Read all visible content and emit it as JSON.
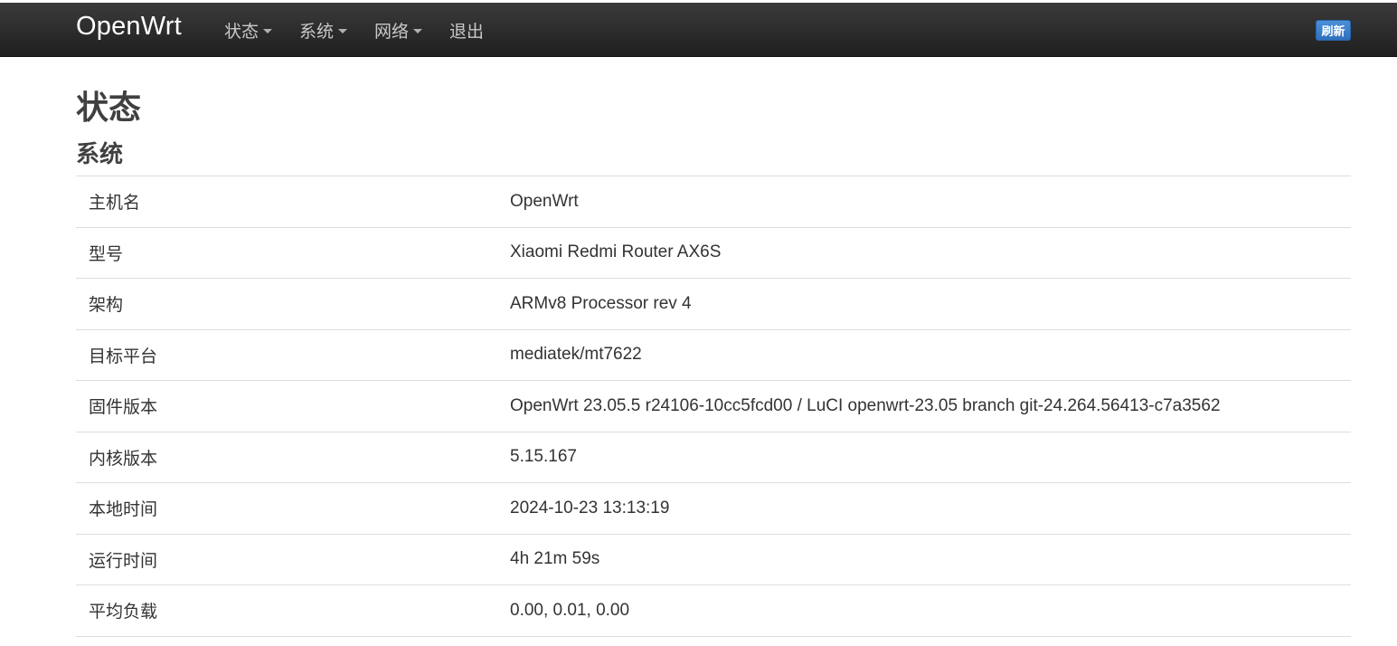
{
  "navbar": {
    "brand": "OpenWrt",
    "menu": [
      {
        "label": "状态",
        "dropdown": true
      },
      {
        "label": "系统",
        "dropdown": true
      },
      {
        "label": "网络",
        "dropdown": true
      },
      {
        "label": "退出",
        "dropdown": false
      }
    ],
    "refresh_label": "刷新"
  },
  "page": {
    "title": "状态",
    "section_title": "系统"
  },
  "system_info": [
    {
      "label": "主机名",
      "value": "OpenWrt"
    },
    {
      "label": "型号",
      "value": "Xiaomi Redmi Router AX6S"
    },
    {
      "label": "架构",
      "value": "ARMv8 Processor rev 4"
    },
    {
      "label": "目标平台",
      "value": "mediatek/mt7622"
    },
    {
      "label": "固件版本",
      "value": "OpenWrt 23.05.5 r24106-10cc5fcd00 / LuCI openwrt-23.05 branch git-24.264.56413-c7a3562"
    },
    {
      "label": "内核版本",
      "value": "5.15.167"
    },
    {
      "label": "本地时间",
      "value": "2024-10-23 13:13:19"
    },
    {
      "label": "运行时间",
      "value": "4h 21m 59s"
    },
    {
      "label": "平均负载",
      "value": "0.00, 0.01, 0.00"
    }
  ],
  "colors": {
    "navbar_bg": "#2a2a2a",
    "refresh_button": "#3a7cc9"
  }
}
